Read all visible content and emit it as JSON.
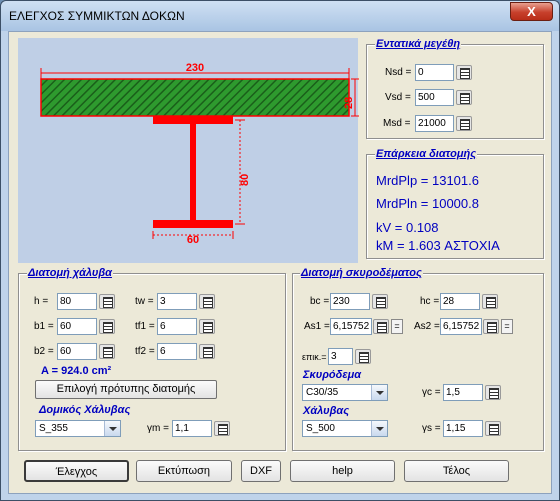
{
  "window": {
    "title": "ΕΛΕΓΧΟΣ ΣΥΜΜΙΚΤΩΝ ΔΟΚΩΝ",
    "close_label": "X"
  },
  "drawing": {
    "slab_width": "230",
    "slab_height": "28",
    "web_height": "80",
    "flange_width": "60"
  },
  "forces": {
    "title": "Εντατικά μεγέθη",
    "nsd_label": "Nsd =",
    "nsd_value": "0",
    "vsd_label": "Vsd =",
    "vsd_value": "500",
    "msd_label": "Msd =",
    "msd_value": "21000"
  },
  "capacity": {
    "title": "Επάρκεια διατομής",
    "mrdplp": "MrdPlp = 13101.6",
    "mrdpln": "MrdPln = 10000.8",
    "kv": "kV = 0.108",
    "km": "kM = 1.603  ΑΣΤΟΧΙΑ"
  },
  "steel_section": {
    "title": "Διατομή χάλυβα",
    "h_label": "h =",
    "h_value": "80",
    "tw_label": "tw =",
    "tw_value": "3",
    "b1_label": "b1 =",
    "b1_value": "60",
    "tf1_label": "tf1 =",
    "tf1_value": "6",
    "b2_label": "b2 =",
    "b2_value": "60",
    "tf2_label": "tf2 =",
    "tf2_value": "6",
    "area": "A = 924.0 cm²",
    "standard_button": "Επιλογή πρότυπης διατομής",
    "steel_label": "Δομικός Χάλυβας",
    "steel_value": "S_355",
    "gm_label": "γm =",
    "gm_value": "1,1"
  },
  "concrete_section": {
    "title": "Διατομή σκυροδέματος",
    "bc_label": "bc =",
    "bc_value": "230",
    "hc_label": "hc =",
    "hc_value": "28",
    "as1_label": "As1 =",
    "as1_value": "6,15752",
    "as2_label": "As2 =",
    "as2_value": "6,15752",
    "eq_label": "=",
    "cover_label": "επικ.=",
    "cover_value": "3",
    "concrete_label": "Σκυρόδεμα",
    "concrete_value": "C30/35",
    "gc_label": "γc =",
    "gc_value": "1,5",
    "rebar_label": "Χάλυβας",
    "rebar_value": "S_500",
    "gs_label": "γs =",
    "gs_value": "1,15"
  },
  "buttons": {
    "check": "Έλεγχος",
    "print": "Εκτύπωση",
    "dxf": "DXF",
    "help": "help",
    "end": "Τέλος"
  },
  "colors": {
    "section_red": "#ff0000",
    "slab_green": "#2e9a2e",
    "slab_hatch": "#1a5f1a",
    "drawing_bg": "#bfcfe6",
    "label_blue": "#0000c0"
  }
}
